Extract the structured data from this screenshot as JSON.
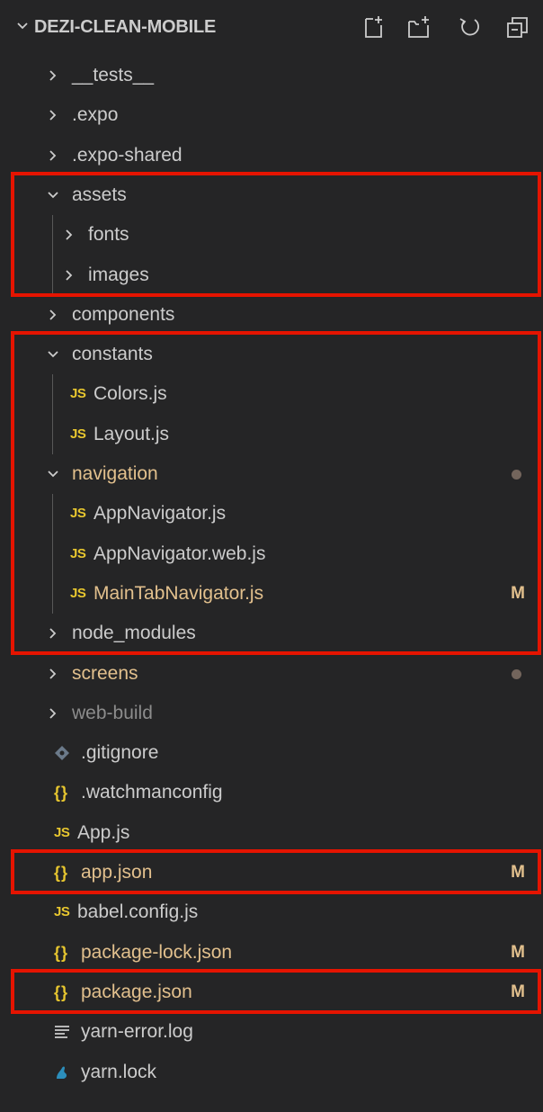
{
  "explorer": {
    "title": "DEZI-CLEAN-MOBILE",
    "actions": [
      {
        "name": "new-file",
        "icon": "new-file-icon"
      },
      {
        "name": "new-folder",
        "icon": "new-folder-icon"
      },
      {
        "name": "refresh",
        "icon": "refresh-icon"
      },
      {
        "name": "collapse-all",
        "icon": "collapse-all-icon"
      }
    ],
    "items": [
      {
        "label": "__tests__",
        "kind": "folder",
        "state": "collapsed",
        "depth": 0
      },
      {
        "label": ".expo",
        "kind": "folder",
        "state": "collapsed",
        "depth": 0
      },
      {
        "label": ".expo-shared",
        "kind": "folder",
        "state": "collapsed",
        "depth": 0
      },
      {
        "label": "assets",
        "kind": "folder",
        "state": "expanded",
        "depth": 0
      },
      {
        "label": "fonts",
        "kind": "folder",
        "state": "collapsed",
        "depth": 1
      },
      {
        "label": "images",
        "kind": "folder",
        "state": "collapsed",
        "depth": 1
      },
      {
        "label": "components",
        "kind": "folder",
        "state": "collapsed",
        "depth": 0
      },
      {
        "label": "constants",
        "kind": "folder",
        "state": "expanded",
        "depth": 0
      },
      {
        "label": "Colors.js",
        "kind": "js",
        "depth": 1
      },
      {
        "label": "Layout.js",
        "kind": "js",
        "depth": 1
      },
      {
        "label": "navigation",
        "kind": "folder",
        "state": "expanded",
        "depth": 0,
        "status": "dot",
        "color": "modified"
      },
      {
        "label": "AppNavigator.js",
        "kind": "js",
        "depth": 1
      },
      {
        "label": "AppNavigator.web.js",
        "kind": "js",
        "depth": 1
      },
      {
        "label": "MainTabNavigator.js",
        "kind": "js",
        "depth": 1,
        "badge": "M",
        "color": "modified"
      },
      {
        "label": "node_modules",
        "kind": "folder",
        "state": "collapsed",
        "depth": 0
      },
      {
        "label": "screens",
        "kind": "folder",
        "state": "collapsed",
        "depth": 0,
        "status": "dot",
        "color": "modified"
      },
      {
        "label": "web-build",
        "kind": "folder",
        "state": "collapsed",
        "depth": 0,
        "color": "dim"
      },
      {
        "label": ".gitignore",
        "kind": "git",
        "depth": 0
      },
      {
        "label": ".watchmanconfig",
        "kind": "json",
        "depth": 0
      },
      {
        "label": "App.js",
        "kind": "js",
        "depth": 0
      },
      {
        "label": "app.json",
        "kind": "json",
        "depth": 0,
        "badge": "M",
        "color": "modified"
      },
      {
        "label": "babel.config.js",
        "kind": "js",
        "depth": 0
      },
      {
        "label": "package-lock.json",
        "kind": "json",
        "depth": 0,
        "badge": "M",
        "color": "modified"
      },
      {
        "label": "package.json",
        "kind": "json",
        "depth": 0,
        "badge": "M",
        "color": "modified"
      },
      {
        "label": "yarn-error.log",
        "kind": "log",
        "depth": 0
      },
      {
        "label": "yarn.lock",
        "kind": "yarn",
        "depth": 0
      }
    ]
  },
  "icon_text": {
    "js": "JS",
    "json": "{}"
  },
  "colors": {
    "background": "#252526",
    "text": "#cccccc",
    "modified": "#e2c08d",
    "dim": "#8c8c8c",
    "js": "#e8c72f",
    "highlight": "#e51400",
    "dot": "#73655c"
  },
  "highlights": [
    {
      "from": "assets",
      "to": "images"
    },
    {
      "from": "constants",
      "to": "node_modules"
    },
    {
      "from": "app.json",
      "to": "app.json"
    },
    {
      "from": "package.json",
      "to": "package.json"
    }
  ]
}
